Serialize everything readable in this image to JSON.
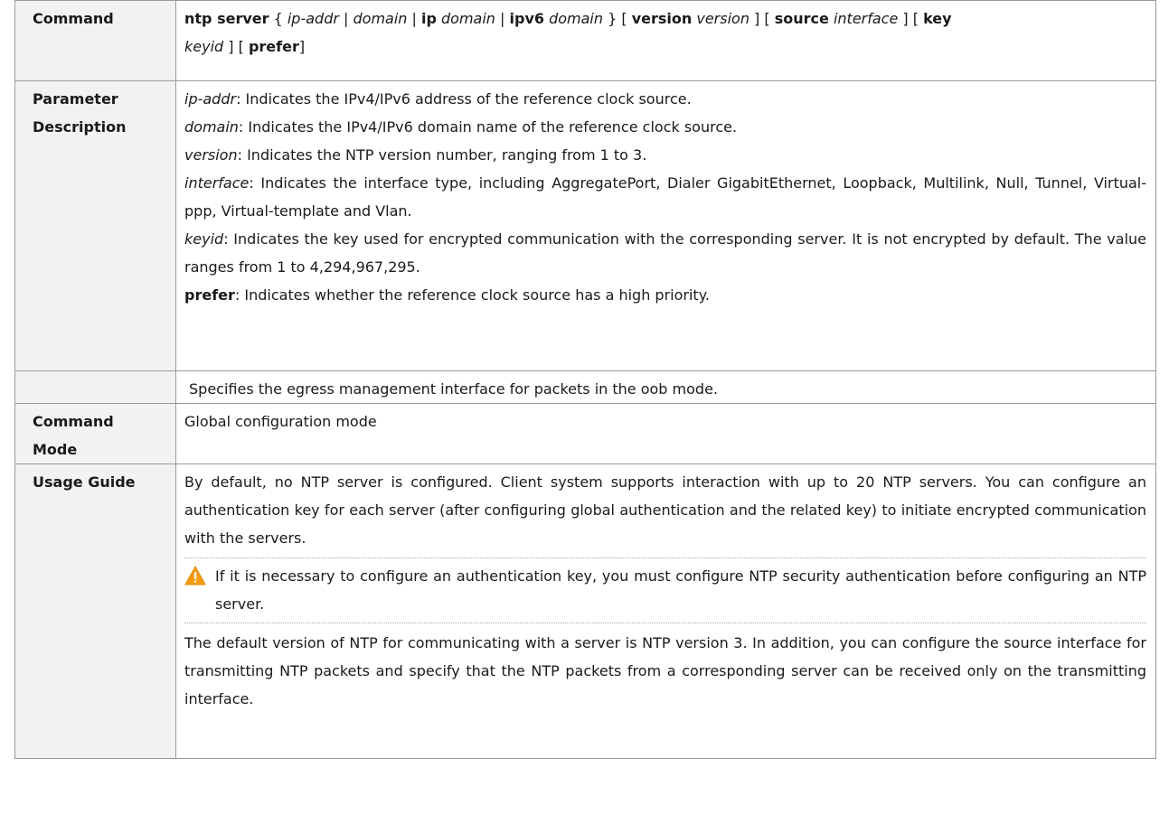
{
  "rows": {
    "command": {
      "header": "Command",
      "syntax": {
        "cmd": "ntp server",
        "p1": " { ",
        "ipaddr": "ip-addr",
        "sep1": " | ",
        "domain1": "domain",
        "sep2": " | ",
        "ip": "ip",
        "sp1": " ",
        "domain2": "domain",
        "sep3": " | ",
        "ipv6": "ipv6",
        "sp2": " ",
        "domain3": "domain",
        "p2": " } [ ",
        "version_kw": "version",
        "sp3": " ",
        "version_arg": "version",
        "p3": " ] [ ",
        "source_kw": "source",
        "sp4": " ",
        "interface_arg": "interface",
        "p4": " ] [ ",
        "key_kw": "key",
        "keyid_arg": "keyid",
        "p5": " ] [ ",
        "prefer_kw": "prefer",
        "p6": "]"
      }
    },
    "params": {
      "header_line1": "Parameter",
      "header_line2": "Description",
      "items": [
        {
          "term": "ip-addr",
          "desc": ": Indicates the IPv4/IPv6 address of the reference clock source."
        },
        {
          "term": "domain",
          "desc": ": Indicates the IPv4/IPv6 domain name of the reference clock source."
        },
        {
          "term": "version",
          "desc": ": Indicates the NTP version number, ranging from 1 to 3."
        },
        {
          "term": "interface",
          "desc": ": Indicates the interface type, including AggregatePort, Dialer GigabitEthernet, Loopback, Multilink, Null, Tunnel, Virtual-ppp, Virtual-template and Vlan."
        },
        {
          "term": "keyid",
          "desc": ": Indicates the key used for encrypted communication with the corresponding server. It is not encrypted by default. The value ranges from 1 to 4,294,967,295."
        },
        {
          "term": "prefer",
          "desc": ": Indicates whether the reference clock source has a high priority."
        }
      ]
    },
    "oob": {
      "header": "",
      "text": "Specifies the egress management interface for packets in the oob mode."
    },
    "mode": {
      "header_line1": "Command",
      "header_line2": "Mode",
      "text": "Global configuration mode"
    },
    "usage": {
      "header": "Usage Guide",
      "para1": "By default, no NTP server is configured. Client system supports interaction with up to 20 NTP servers. You can configure an authentication key for each server (after configuring global authentication and the related key) to initiate encrypted communication with the servers.",
      "note": "If it is necessary to configure an authentication key, you must configure NTP security authentication before configuring an NTP server.",
      "para2": "The default version of NTP for communicating with a server is NTP version 3. In addition, you can configure the source interface for transmitting NTP packets and specify that the NTP packets from a corresponding server can be received only on the transmitting interface."
    }
  },
  "icons": {
    "warning": "warning-triangle-icon",
    "warning_color": "#f39c12"
  }
}
